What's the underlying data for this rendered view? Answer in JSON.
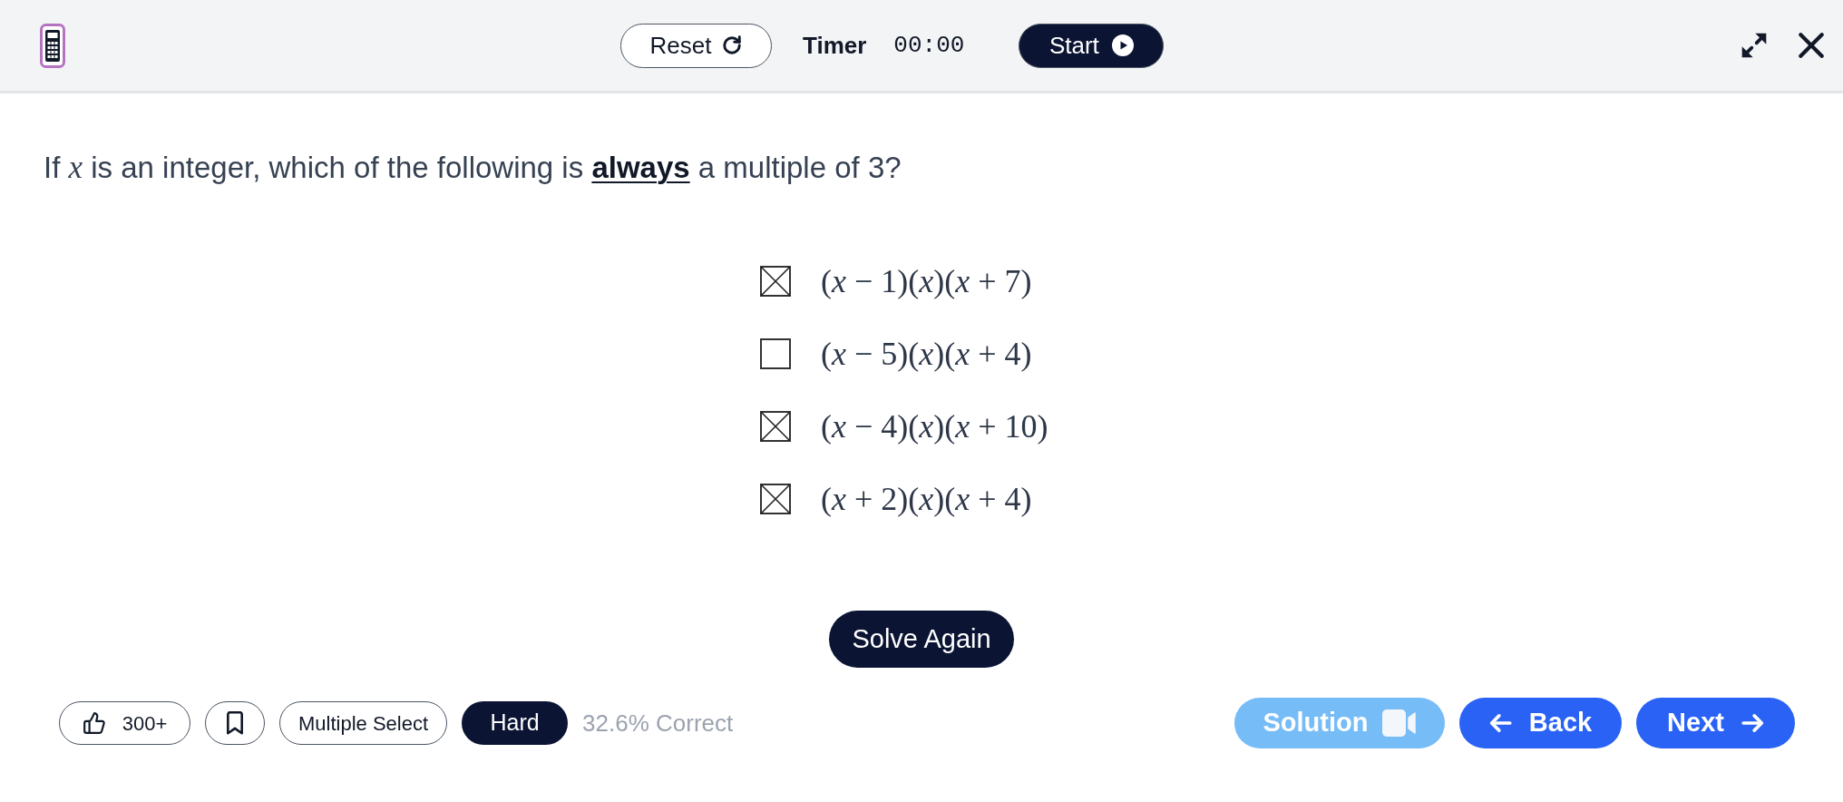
{
  "toolbar": {
    "reset_label": "Reset",
    "timer_label": "Timer",
    "timer_value": "00:00",
    "start_label": "Start"
  },
  "question": {
    "text": "If *x* is an integer, which of the following is **always** a multiple of 3?"
  },
  "choices": [
    {
      "expression": "(*x* − 1)(*x*)(*x* + 7)",
      "checked": true
    },
    {
      "expression": "(*x* − 5)(*x*)(*x* + 4)",
      "checked": false
    },
    {
      "expression": "(*x* − 4)(*x*)(*x* + 10)",
      "checked": true
    },
    {
      "expression": "(*x* + 2)(*x*)(*x* + 4)",
      "checked": true
    }
  ],
  "solve_again": "Solve Again",
  "footer": {
    "likes": "300+",
    "question_type": "Multiple Select",
    "difficulty": "Hard",
    "accuracy": "32.6% Correct",
    "solution": "Solution",
    "back": "Back",
    "next": "Next"
  }
}
